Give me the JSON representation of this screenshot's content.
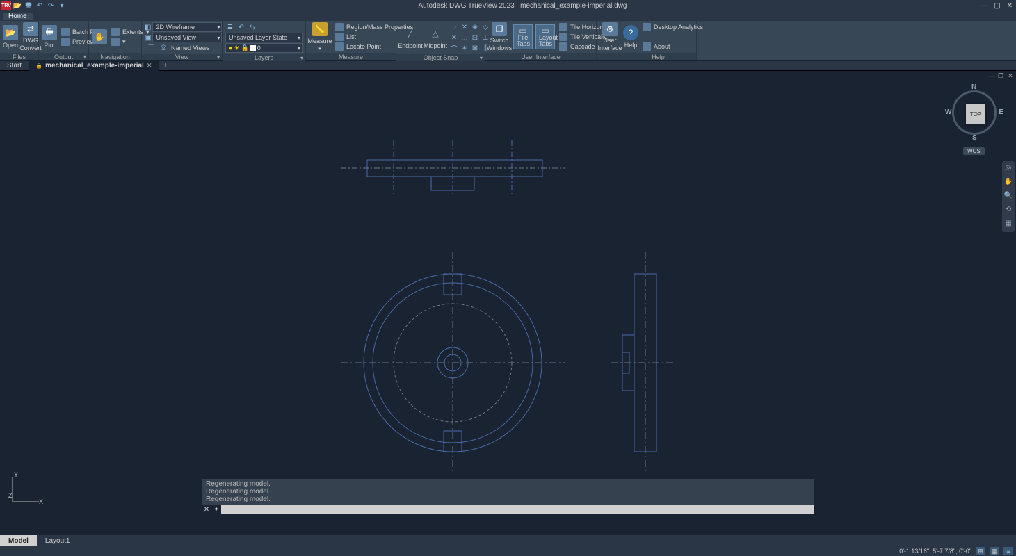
{
  "titlebar": {
    "app_badge": "TRV",
    "title": "Autodesk DWG TrueView 2023",
    "filename": "mechanical_example-imperial.dwg"
  },
  "menu": {
    "home": "Home"
  },
  "ribbon": {
    "files": {
      "label": "Files",
      "open": "Open",
      "dwg_convert_l1": "DWG",
      "dwg_convert_l2": "Convert"
    },
    "output": {
      "label": "Output",
      "plot": "Plot",
      "batch_plot": "Batch Plot",
      "preview": "Preview"
    },
    "navigation": {
      "label": "Navigation",
      "extents": "Extents"
    },
    "view": {
      "label": "View",
      "visual_style": "2D Wireframe",
      "unsaved_view": "Unsaved View",
      "named_views": "Named Views"
    },
    "layers": {
      "label": "Layers",
      "layer_state": "Unsaved Layer State",
      "current_layer": "0"
    },
    "measure": {
      "label": "Measure",
      "measure": "Measure",
      "region": "Region/Mass Properties",
      "list": "List",
      "locate": "Locate Point"
    },
    "osnap": {
      "label": "Object Snap",
      "endpoint": "Endpoint",
      "midpoint": "Midpoint"
    },
    "ui": {
      "label": "User Interface",
      "switch_l1": "Switch",
      "switch_l2": "Windows",
      "file_tabs": "File Tabs",
      "layout_l1": "Layout",
      "layout_l2": "Tabs",
      "tile_h": "Tile Horizontally",
      "tile_v": "Tile Vertically",
      "cascade": "Cascade"
    },
    "user": {
      "label": "",
      "interface_l1": "User",
      "interface_l2": "Interface"
    },
    "help": {
      "label": "Help",
      "help": "Help",
      "desktop_analytics": "Desktop Analytics",
      "about": "About"
    }
  },
  "filetabs": {
    "start": "Start",
    "file": "mechanical_example-imperial",
    "add": "+"
  },
  "viewcube": {
    "face": "TOP",
    "n": "N",
    "s": "S",
    "e": "E",
    "w": "W",
    "wcs": "WCS"
  },
  "ucs": {
    "x": "X",
    "y": "Y",
    "z": "Z"
  },
  "command": {
    "history": [
      "Regenerating model.",
      "Regenerating model.",
      "Regenerating model."
    ],
    "prompt": ""
  },
  "model_tabs": {
    "model": "Model",
    "layout1": "Layout1"
  },
  "status": {
    "coords": "0'-1 13/16\", 5'-7 7/8\", 0'-0\""
  }
}
